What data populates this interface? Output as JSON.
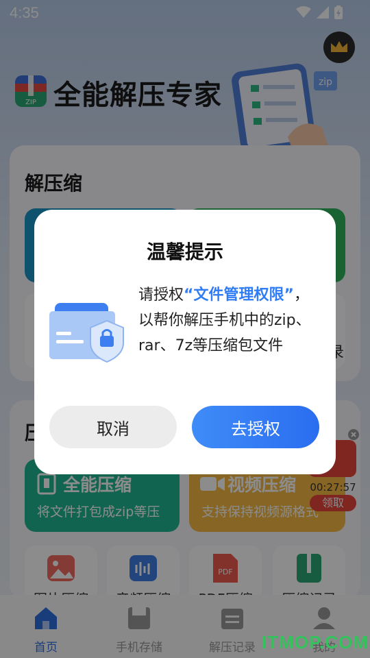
{
  "status_bar": {
    "time": "4:35"
  },
  "header": {
    "app_title": "全能解压专家"
  },
  "sections": {
    "decompress_title": "解压缩",
    "compress_title_partial": "压"
  },
  "dialog": {
    "title": "温馨提示",
    "message_prefix": "请授权",
    "message_highlight": "“文件管理权限”",
    "message_suffix": "，以帮你解压手机中的zip、rar、7z等压缩包文件",
    "cancel_label": "取消",
    "confirm_label": "去授权"
  },
  "tiles": [
    {
      "title": "全能压缩",
      "subtitle": "将文件打包成zip等压",
      "color": "#1fb992"
    },
    {
      "title": "视频压缩",
      "subtitle": "支持保持视频源格式",
      "color": "#f6b843"
    }
  ],
  "small_tiles": [
    {
      "label": "图片压缩",
      "icon": "image-icon"
    },
    {
      "label": "音频压缩",
      "icon": "audio-icon"
    },
    {
      "label": "PDF压缩",
      "icon": "pdf-icon"
    },
    {
      "label": "压缩记录",
      "icon": "zip-record-icon"
    }
  ],
  "promo": {
    "timer": "00:27:57",
    "claim_label": "领取"
  },
  "side_text": "录",
  "nav": [
    {
      "label": "首页",
      "active": true
    },
    {
      "label": "手机存储",
      "active": false
    },
    {
      "label": "解压记录",
      "active": false
    },
    {
      "label": "我的",
      "active": false
    }
  ],
  "watermark": "ITMOP.COM",
  "colors": {
    "accent": "#2f7cf6",
    "active_nav": "#2f6fe0"
  }
}
